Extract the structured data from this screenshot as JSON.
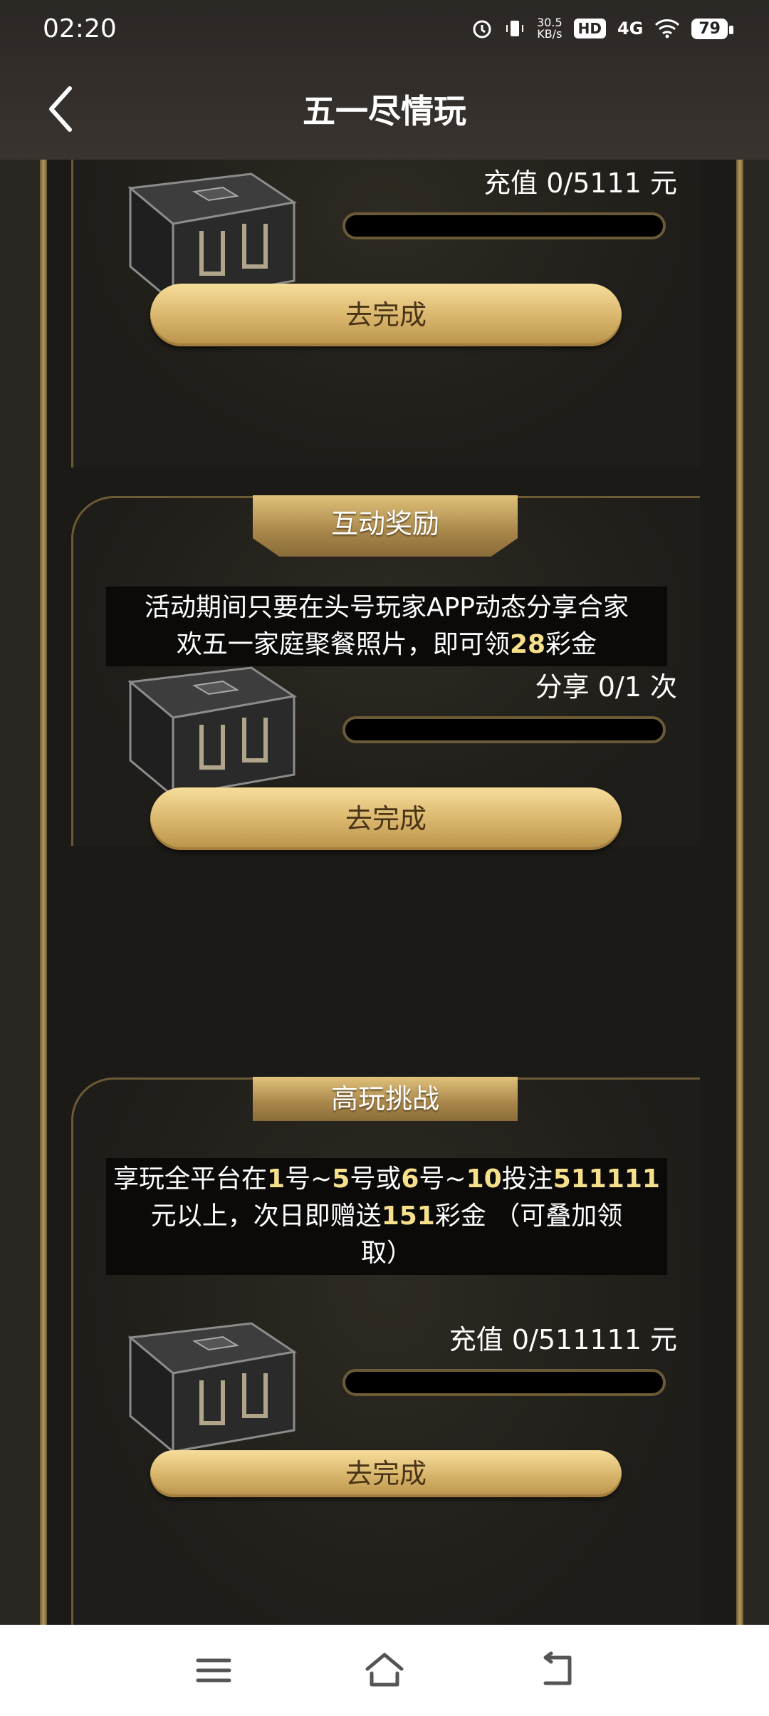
{
  "status_bar": {
    "time": "02:20",
    "speed_value": "30.5",
    "speed_unit": "KB/s",
    "hd": "HD",
    "network": "4G",
    "battery": "79"
  },
  "header": {
    "title": "五一尽情玩"
  },
  "cards": [
    {
      "progress_label": "充值 0/5111 元",
      "progress": 0,
      "button": "去完成"
    },
    {
      "title": "互动奖励",
      "desc_line1": "活动期间只要在头号玩家APP动态分享合家",
      "desc_line2_a": "欢五一家庭聚餐照片，即可领",
      "desc_line2_hl": "28",
      "desc_line2_b": "彩金",
      "progress_label": "分享 0/1 次",
      "progress": 0,
      "button": "去完成"
    },
    {
      "title": "高玩挑战",
      "d1": "享玩全平台在",
      "d2": "1",
      "d3": "号~",
      "d4": "5",
      "d5": "号或",
      "d6": "6",
      "d7": "号~",
      "d8": "10",
      "d9": "投注",
      "d10": "511111",
      "d11": "元以上，次日即赠送",
      "d12": "151",
      "d13": "彩金 （可叠加领",
      "d14": "取）",
      "progress_label": "充值 0/511111 元",
      "progress": 0,
      "button": "去完成"
    }
  ],
  "colors": {
    "gold": "#d8b46a",
    "highlight": "#f7e08c",
    "background": "#1c1a17"
  }
}
